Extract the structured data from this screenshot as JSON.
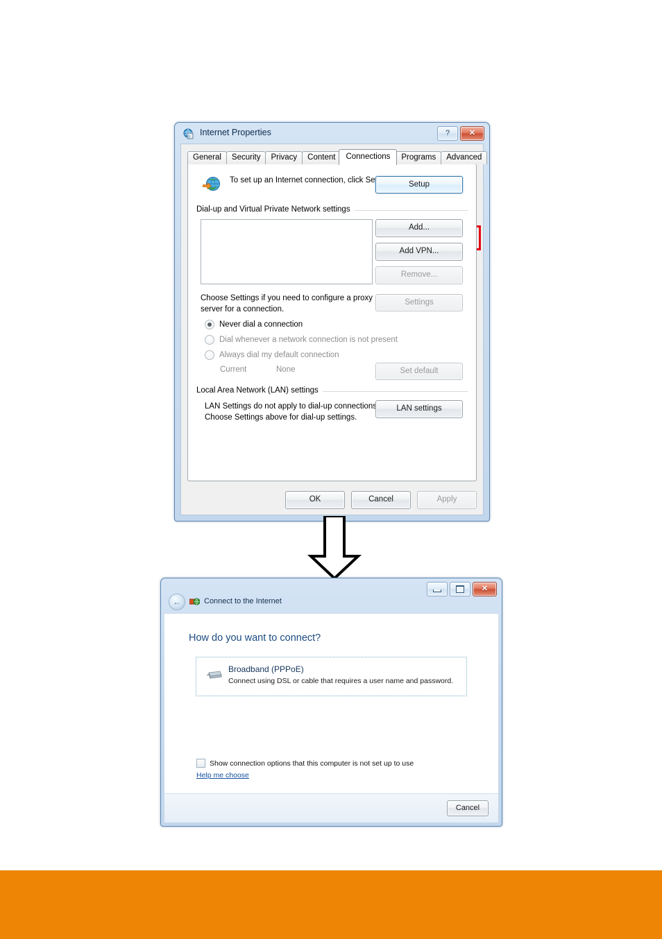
{
  "internet_properties": {
    "title": "Internet Properties",
    "title_icon": "internet-properties-icon",
    "help_button": "?",
    "close_button": "✕",
    "tabs": [
      {
        "label": "General",
        "active": false
      },
      {
        "label": "Security",
        "active": false
      },
      {
        "label": "Privacy",
        "active": false
      },
      {
        "label": "Content",
        "active": false
      },
      {
        "label": "Connections",
        "active": true
      },
      {
        "label": "Programs",
        "active": false
      },
      {
        "label": "Advanced",
        "active": false
      }
    ],
    "setup": {
      "icon": "globe-with-arrow-icon",
      "text": "To set up an Internet connection, click Setup.",
      "button_label": "Setup"
    },
    "dialup_group": {
      "title": "Dial-up and Virtual Private Network settings",
      "list_items": [],
      "add_label": "Add...",
      "add_vpn_label": "Add VPN...",
      "remove_label": "Remove...",
      "remove_disabled": true
    },
    "proxy": {
      "text": "Choose Settings if you need to configure a proxy server for a connection.",
      "settings_label": "Settings",
      "settings_disabled": true,
      "options": [
        {
          "label": "Never dial a connection",
          "checked": true,
          "disabled": false
        },
        {
          "label": "Dial whenever a network connection is not present",
          "checked": false,
          "disabled": true
        },
        {
          "label": "Always dial my default connection",
          "checked": false,
          "disabled": true
        }
      ],
      "current_label": "Current",
      "current_value": "None",
      "set_default_label": "Set default",
      "set_default_disabled": true
    },
    "lan_group": {
      "title": "Local Area Network (LAN) settings",
      "text": "LAN Settings do not apply to dial-up connections. Choose Settings above for dial-up settings.",
      "lan_settings_label": "LAN settings"
    },
    "footer": {
      "ok_label": "OK",
      "cancel_label": "Cancel",
      "apply_label": "Apply",
      "apply_disabled": true
    }
  },
  "connect_wizard": {
    "title": "Connect to the Internet",
    "title_icon": "network-connection-icon",
    "back_button": "←",
    "minimize_button": "minimize-icon",
    "maximize_button": "maximize-icon",
    "close_button": "✕",
    "question": "How do you want to connect?",
    "option": {
      "icon": "broadband-modem-icon",
      "title_prefix": "Br",
      "title_accel": "o",
      "title_suffix": "adband (PPPoE)",
      "title_full": "Broadband (PPPoE)",
      "description": "Connect using DSL or cable that requires a user name and password."
    },
    "show_options_checkbox": {
      "label": "Show connection options that this computer is not set up to use",
      "checked": false
    },
    "help_link": "Help me choose",
    "cancel_label": "Cancel"
  },
  "annotations": {
    "highlight_target": "Add...",
    "highlight_color": "#e30613",
    "flow_arrow": "down-arrow"
  },
  "footer_bar": {
    "color": "#ef8505"
  }
}
